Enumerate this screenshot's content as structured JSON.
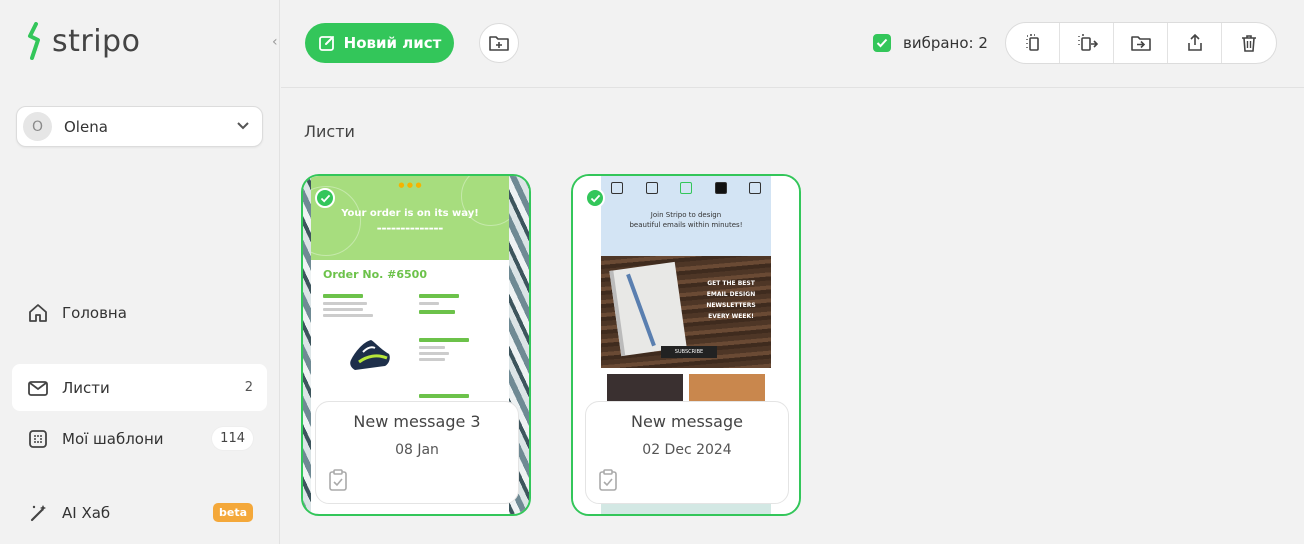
{
  "app": {
    "logo_text": "stripo"
  },
  "user": {
    "avatar_initial": "O",
    "name": "Olena"
  },
  "nav": [
    {
      "label": "Головна",
      "count": ""
    },
    {
      "label": "Листи",
      "count": "2"
    },
    {
      "label": "Мої шаблони",
      "count": "114"
    },
    {
      "label": "AI Хаб",
      "badge": "beta"
    }
  ],
  "toolbar": {
    "new_button_label": "Новий лист",
    "selected_label": "вибрано: 2"
  },
  "section": {
    "title": "Листи"
  },
  "cards": [
    {
      "title": "New message 3",
      "date": "08 Jan",
      "preview": {
        "header_title": "Your order is on its way!",
        "order_number": "Order No. #6500"
      }
    },
    {
      "title": "New message",
      "date": "02 Dec 2024",
      "preview": {
        "join_line1": "Join Stripo to design",
        "join_line2": "beautiful emails within minutes!",
        "wood_text": "GET THE BEST EMAIL DESIGN NEWSLETTERS EVERY WEEK!",
        "subscribe": "SUBSCRIBE"
      }
    }
  ],
  "colors": {
    "accent": "#33c65a",
    "beta": "#f4a83a"
  }
}
